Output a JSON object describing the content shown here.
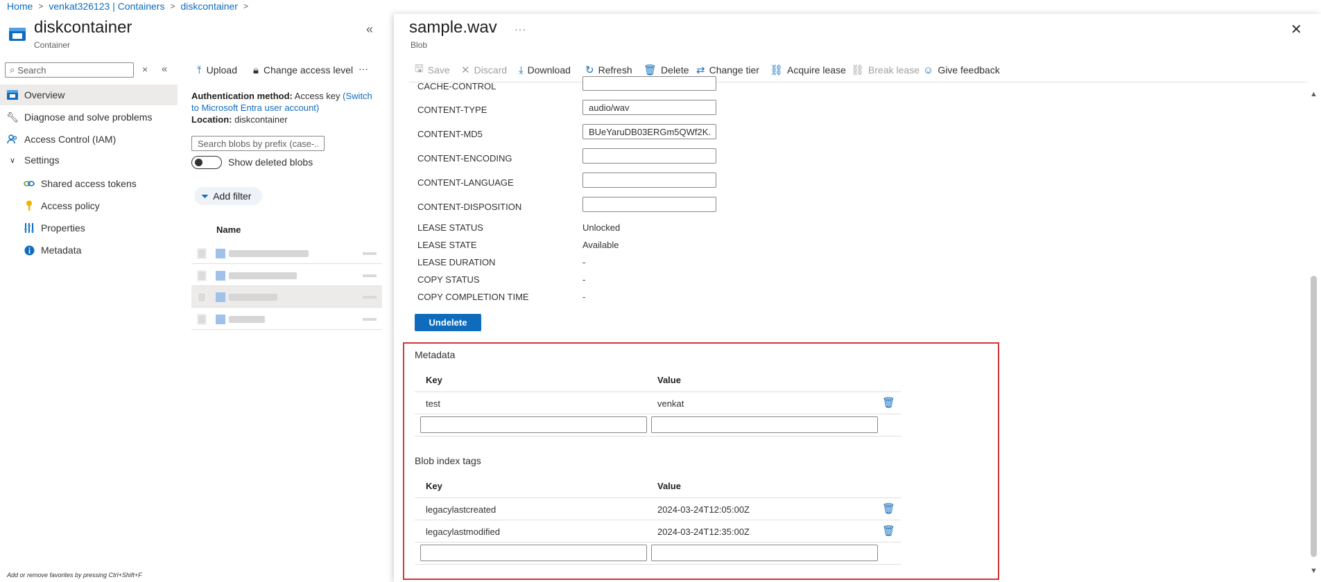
{
  "breadcrumb": [
    "Home",
    "venkat326123 | Containers",
    "diskcontainer"
  ],
  "left": {
    "title": "diskcontainer",
    "subtitle": "Container",
    "search_placeholder": "Search",
    "nav": [
      {
        "label": "Overview",
        "icon": "container-icon",
        "active": true
      },
      {
        "label": "Diagnose and solve problems",
        "icon": "wrench-icon"
      },
      {
        "label": "Access Control (IAM)",
        "icon": "people-icon"
      },
      {
        "label": "Settings",
        "icon": "chevron-down-icon"
      },
      {
        "label": "Shared access tokens",
        "icon": "link-icon"
      },
      {
        "label": "Access policy",
        "icon": "key-icon"
      },
      {
        "label": "Properties",
        "icon": "bars-icon"
      },
      {
        "label": "Metadata",
        "icon": "info-icon"
      }
    ],
    "fav_hint": "Add or remove favorites by pressing Ctrl+Shift+F"
  },
  "middle": {
    "toolbar": {
      "upload": "Upload",
      "change_access": "Change access level",
      "more": "···"
    },
    "auth_label": "Authentication method:",
    "auth_value": "Access key",
    "auth_link": "(Switch to Microsoft Entra user account)",
    "location_label": "Location:",
    "location_value": "diskcontainer",
    "blob_search_placeholder": "Search blobs by prefix (case-...",
    "show_deleted": "Show deleted blobs",
    "add_filter": "Add filter",
    "name_header": "Name"
  },
  "blob": {
    "title": "sample.wav",
    "subtitle": "Blob",
    "more": "···",
    "toolbar": {
      "save": "Save",
      "discard": "Discard",
      "download": "Download",
      "refresh": "Refresh",
      "delete": "Delete",
      "change_tier": "Change tier",
      "acquire_lease": "Acquire lease",
      "break_lease": "Break lease",
      "give_feedback": "Give feedback"
    },
    "props": {
      "cache_control_label": "CACHE-CONTROL",
      "content_type_label": "CONTENT-TYPE",
      "content_type_value": "audio/wav",
      "content_md5_label": "CONTENT-MD5",
      "content_md5_value": "BUeYaruDB03ERGm5QWf2K...",
      "content_encoding_label": "CONTENT-ENCODING",
      "content_language_label": "CONTENT-LANGUAGE",
      "content_disposition_label": "CONTENT-DISPOSITION",
      "lease_status_label": "LEASE STATUS",
      "lease_status_value": "Unlocked",
      "lease_state_label": "LEASE STATE",
      "lease_state_value": "Available",
      "lease_duration_label": "LEASE DURATION",
      "lease_duration_value": "-",
      "copy_status_label": "COPY STATUS",
      "copy_status_value": "-",
      "copy_completion_label": "COPY COMPLETION TIME",
      "copy_completion_value": "-"
    },
    "undelete": "Undelete",
    "metadata": {
      "title": "Metadata",
      "key_header": "Key",
      "value_header": "Value",
      "rows": [
        {
          "key": "test",
          "value": "venkat"
        }
      ]
    },
    "tags": {
      "title": "Blob index tags",
      "key_header": "Key",
      "value_header": "Value",
      "rows": [
        {
          "key": "legacylastcreated",
          "value": "2024-03-24T12:05:00Z"
        },
        {
          "key": "legacylastmodified",
          "value": "2024-03-24T12:35:00Z"
        }
      ]
    }
  }
}
